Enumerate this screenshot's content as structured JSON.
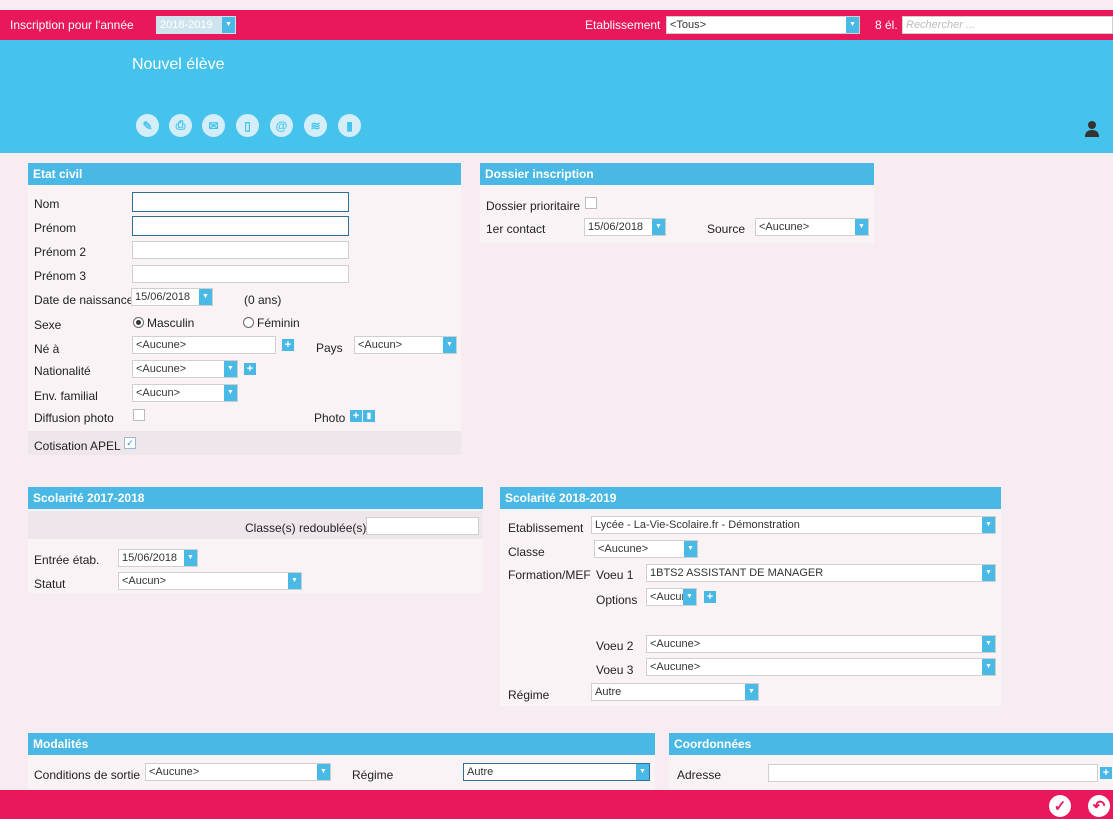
{
  "topbar": {
    "year_label": "Inscription pour l'année",
    "year_value": "2018-2019",
    "etab_label": "Etablissement",
    "etab_value": "<Tous>",
    "count": "8 él.",
    "search_placeholder": "Rechercher ..."
  },
  "header": {
    "title": "Nouvel élève",
    "toolbar": [
      "pencil-icon",
      "print-icon",
      "mail-icon",
      "mobile-icon",
      "at-icon",
      "transfer-icon",
      "trash-icon"
    ]
  },
  "etat_civil": {
    "title": "Etat civil",
    "nom_label": "Nom",
    "prenom_label": "Prénom",
    "prenom2_label": "Prénom 2",
    "prenom3_label": "Prénom 3",
    "dob_label": "Date de naissance",
    "dob_value": "15/06/2018",
    "age": "(0 ans)",
    "sexe_label": "Sexe",
    "masculin": "Masculin",
    "feminin": "Féminin",
    "ne_a_label": "Né à",
    "ne_a_value": "<Aucune>",
    "pays_label": "Pays",
    "pays_value": "<Aucun>",
    "nationalite_label": "Nationalité",
    "nationalite_value": "<Aucune>",
    "env_label": "Env. familial",
    "env_value": "<Aucun>",
    "diffusion_label": "Diffusion photo",
    "photo_label": "Photo",
    "apel_label": "Cotisation APEL",
    "apel_checked": true
  },
  "dossier": {
    "title": "Dossier inscription",
    "prioritaire_label": "Dossier prioritaire",
    "contact_label": "1er contact",
    "contact_value": "15/06/2018",
    "source_label": "Source",
    "source_value": "<Aucune>"
  },
  "scol_prev": {
    "title": "Scolarité 2017-2018",
    "redoublee_label": "Classe(s) redoublée(s)",
    "entree_label": "Entrée étab.",
    "entree_value": "15/06/2018",
    "statut_label": "Statut",
    "statut_value": "<Aucun>"
  },
  "scol_next": {
    "title": "Scolarité 2018-2019",
    "etab_label": "Etablissement",
    "etab_value": "Lycée - La-Vie-Scolaire.fr - Démonstration",
    "classe_label": "Classe",
    "classe_value": "<Aucune>",
    "formation_label": "Formation/MEF",
    "voeu1_label": "Voeu 1",
    "voeu1_value": "1BTS2  ASSISTANT DE MANAGER",
    "options_label": "Options",
    "options_value": "<Aucune>",
    "voeu2_label": "Voeu 2",
    "voeu2_value": "<Aucune>",
    "voeu3_label": "Voeu 3",
    "voeu3_value": "<Aucune>",
    "regime_label": "Régime",
    "regime_value": "Autre"
  },
  "modalites": {
    "title": "Modalités",
    "sortie_label": "Conditions de sortie",
    "sortie_value": "<Aucune>",
    "regime_label": "Régime",
    "regime_value": "Autre"
  },
  "coordonnees": {
    "title": "Coordonnées",
    "adresse_label": "Adresse"
  },
  "footer": {
    "validate": "✓",
    "undo": "↶"
  }
}
